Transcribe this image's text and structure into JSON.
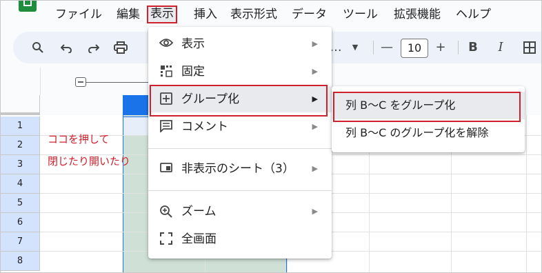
{
  "menubar": {
    "items": [
      "ファイル",
      "編集",
      "表示",
      "挿入",
      "表示形式",
      "データ",
      "ツール",
      "拡張機能",
      "ヘルプ"
    ],
    "active_index": 2
  },
  "toolbar": {
    "font_size": "10",
    "minus": "—",
    "plus": "+",
    "bold": "B",
    "italic": "I",
    "ellipsis": "..."
  },
  "rows": [
    "1",
    "2",
    "3",
    "4",
    "5",
    "6",
    "7",
    "8"
  ],
  "annotation": {
    "line1": "ココを押して",
    "line2": "閉じたり開いたり"
  },
  "view_menu": {
    "items": [
      {
        "icon": "eye-icon",
        "label": "表示",
        "submenu": true
      },
      {
        "icon": "freeze-icon",
        "label": "固定",
        "submenu": true
      },
      {
        "icon": "group-plus-icon",
        "label": "グループ化",
        "submenu": true
      },
      {
        "icon": "comment-icon",
        "label": "コメント",
        "submenu": true
      },
      {
        "icon": "hidden-sheet-icon",
        "label": "非表示のシート（3）",
        "submenu": true
      },
      {
        "icon": "zoom-icon",
        "label": "ズーム",
        "submenu": true
      },
      {
        "icon": "fullscreen-icon",
        "label": "全画面",
        "submenu": false
      }
    ]
  },
  "group_submenu": {
    "items": [
      "列 B〜C をグループ化",
      "列 B〜C のグループ化を解除"
    ]
  },
  "colors": {
    "highlight": "#d0202c",
    "selected_col_header": "#1a73e8",
    "selected_cells": "#cfe0d7",
    "row_header_selected": "#d3e3fd"
  }
}
